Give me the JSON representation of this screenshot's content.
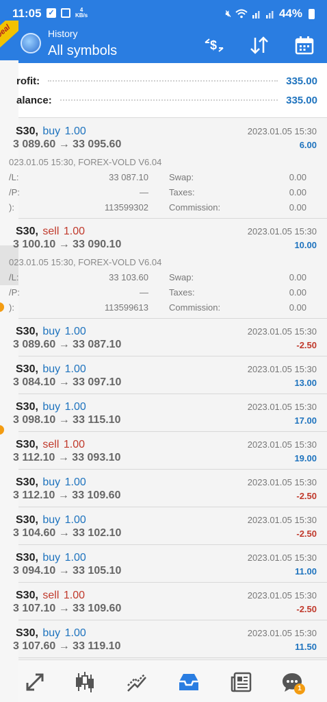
{
  "status_bar": {
    "time": "11:05",
    "data_speed_value": "4",
    "data_speed_unit": "KB/s",
    "battery": "44%"
  },
  "ribbon": {
    "label": "Deal"
  },
  "toolbar": {
    "subtitle": "History",
    "title": "All symbols",
    "icons": [
      "currency-exchange-icon",
      "sort-icon",
      "calendar-icon"
    ]
  },
  "summary": {
    "profit_label": "rofit:",
    "profit_value": "335.00",
    "balance_label": "alance:",
    "balance_value": "335.00"
  },
  "deals": [
    {
      "symbol": "S30,",
      "side": "buy",
      "volume": "1.00",
      "prices": "3 089.60 → 33 095.60",
      "datetime": "2023.01.05 15:30",
      "profit": "6.00",
      "meta": "023.01.05 15:30, FOREX-VOLD V6.04",
      "details": [
        {
          "label": "/L:",
          "value": "33 087.10",
          "label2": "Swap:",
          "value2": "0.00"
        },
        {
          "label": "/P:",
          "value": "—",
          "label2": "Taxes:",
          "value2": "0.00"
        },
        {
          "label": "):",
          "value": "113599302",
          "label2": "Commission:",
          "value2": "0.00"
        }
      ]
    },
    {
      "symbol": "S30,",
      "side": "sell",
      "volume": "1.00",
      "prices": "3 100.10 → 33 090.10",
      "datetime": "2023.01.05 15:30",
      "profit": "10.00",
      "meta": "023.01.05 15:30, FOREX-VOLD V6.04",
      "details": [
        {
          "label": "/L:",
          "value": "33 103.60",
          "label2": "Swap:",
          "value2": "0.00"
        },
        {
          "label": "/P:",
          "value": "—",
          "label2": "Taxes:",
          "value2": "0.00"
        },
        {
          "label": "):",
          "value": "113599613",
          "label2": "Commission:",
          "value2": "0.00"
        }
      ]
    },
    {
      "symbol": "S30,",
      "side": "buy",
      "volume": "1.00",
      "prices": "3 089.60 → 33 087.10",
      "datetime": "2023.01.05 15:30",
      "profit": "-2.50"
    },
    {
      "symbol": "S30,",
      "side": "buy",
      "volume": "1.00",
      "prices": "3 084.10 → 33 097.10",
      "datetime": "2023.01.05 15:30",
      "profit": "13.00"
    },
    {
      "symbol": "S30,",
      "side": "buy",
      "volume": "1.00",
      "prices": "3 098.10 → 33 115.10",
      "datetime": "2023.01.05 15:30",
      "profit": "17.00"
    },
    {
      "symbol": "S30,",
      "side": "sell",
      "volume": "1.00",
      "prices": "3 112.10 → 33 093.10",
      "datetime": "2023.01.05 15:30",
      "profit": "19.00"
    },
    {
      "symbol": "S30,",
      "side": "buy",
      "volume": "1.00",
      "prices": "3 112.10 → 33 109.60",
      "datetime": "2023.01.05 15:30",
      "profit": "-2.50"
    },
    {
      "symbol": "S30,",
      "side": "buy",
      "volume": "1.00",
      "prices": "3 104.60 → 33 102.10",
      "datetime": "2023.01.05 15:30",
      "profit": "-2.50"
    },
    {
      "symbol": "S30,",
      "side": "buy",
      "volume": "1.00",
      "prices": "3 094.10 → 33 105.10",
      "datetime": "2023.01.05 15:30",
      "profit": "11.00"
    },
    {
      "symbol": "S30,",
      "side": "sell",
      "volume": "1.00",
      "prices": "3 107.10 → 33 109.60",
      "datetime": "2023.01.05 15:30",
      "profit": "-2.50"
    },
    {
      "symbol": "S30,",
      "side": "buy",
      "volume": "1.00",
      "prices": "3 107.60 → 33 119.10",
      "datetime": "2023.01.05 15:30",
      "profit": "11.50"
    }
  ],
  "bottom_nav": {
    "items": [
      "quotes-icon",
      "chart-icon",
      "trade-icon",
      "history-icon",
      "news-icon",
      "messages-icon"
    ],
    "active": "history-icon",
    "messages_badge": "1"
  },
  "colors": {
    "header_blue": "#2a7de1",
    "profit_blue": "#1e73be",
    "loss_red": "#c0392b",
    "badge_orange": "#f39c12"
  }
}
